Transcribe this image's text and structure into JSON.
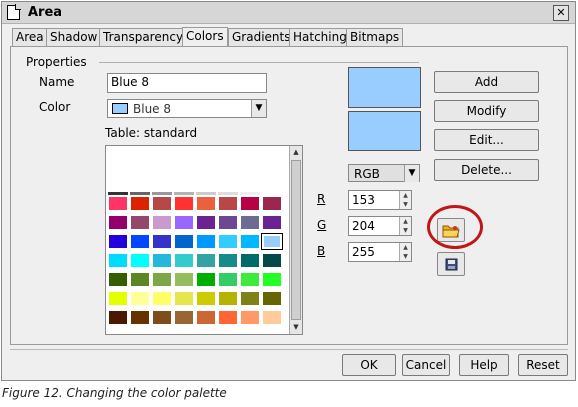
{
  "window": {
    "title": "Area",
    "close_symbol": "✕"
  },
  "tabs": [
    "Area",
    "Shadow",
    "Transparency",
    "Colors",
    "Gradients",
    "Hatching",
    "Bitmaps"
  ],
  "active_tab": "Colors",
  "properties": {
    "group_label": "Properties",
    "name_label": "Name",
    "name_value": "Blue 8",
    "color_label": "Color",
    "color_value": "Blue 8",
    "color_swatch": "#99ccff",
    "table_label": "Table: standard"
  },
  "palette": {
    "partial_row": [
      "#333333",
      "#666666",
      "#999999",
      "#b3b3b3",
      "#cccccc",
      "#dddddd",
      "#eeeeee",
      "#ffffff"
    ],
    "rows": [
      [
        "#ff3366",
        "#dc2300",
        "#b84747",
        "#ff3333",
        "#eb613d",
        "#b84747",
        "#b80047",
        "#99284c"
      ],
      [
        "#94006b",
        "#94476b",
        "#cc99cc",
        "#9966ff",
        "#6b2394",
        "#6b4794",
        "#6b6b94",
        "#6b2394"
      ],
      [
        "#2300dc",
        "#0047ff",
        "#3333cc",
        "#0066cc",
        "#0099ff",
        "#33ccff",
        "#00b8ff",
        "#99ccff"
      ],
      [
        "#00dcff",
        "#00ffff",
        "#23b8dc",
        "#33cccc",
        "#33a3a3",
        "#198a8a",
        "#006b6b",
        "#004a4a"
      ],
      [
        "#355e00",
        "#5c8526",
        "#7da647",
        "#94bd5e",
        "#00ae00",
        "#33cc66",
        "#3deb3d",
        "#23ff23"
      ],
      [
        "#e6ff00",
        "#ffff99",
        "#ffff66",
        "#e6e64c",
        "#cccc00",
        "#b3b300",
        "#808019",
        "#666600"
      ],
      [
        "#4c1900",
        "#663300",
        "#804c19",
        "#996633",
        "#cc6633",
        "#ff6633",
        "#ff9966",
        "#ffcc99"
      ]
    ],
    "selected_row": 2,
    "selected_col": 7
  },
  "preview": {
    "old": "#99ccff",
    "new": "#99ccff"
  },
  "model": {
    "selected": "RGB"
  },
  "rgb": {
    "r_label": "R",
    "r_value": "153",
    "g_label": "G",
    "g_value": "204",
    "b_label": "B",
    "b_value": "255"
  },
  "side_buttons": {
    "add": "Add",
    "modify": "Modify",
    "edit": "Edit...",
    "delete": "Delete..."
  },
  "footer_buttons": {
    "ok": "OK",
    "cancel": "Cancel",
    "help": "Help",
    "reset": "Reset"
  },
  "caption": "Figure 12. Changing the color palette",
  "accent_colors": {
    "highlight_ring": "#c01818"
  }
}
